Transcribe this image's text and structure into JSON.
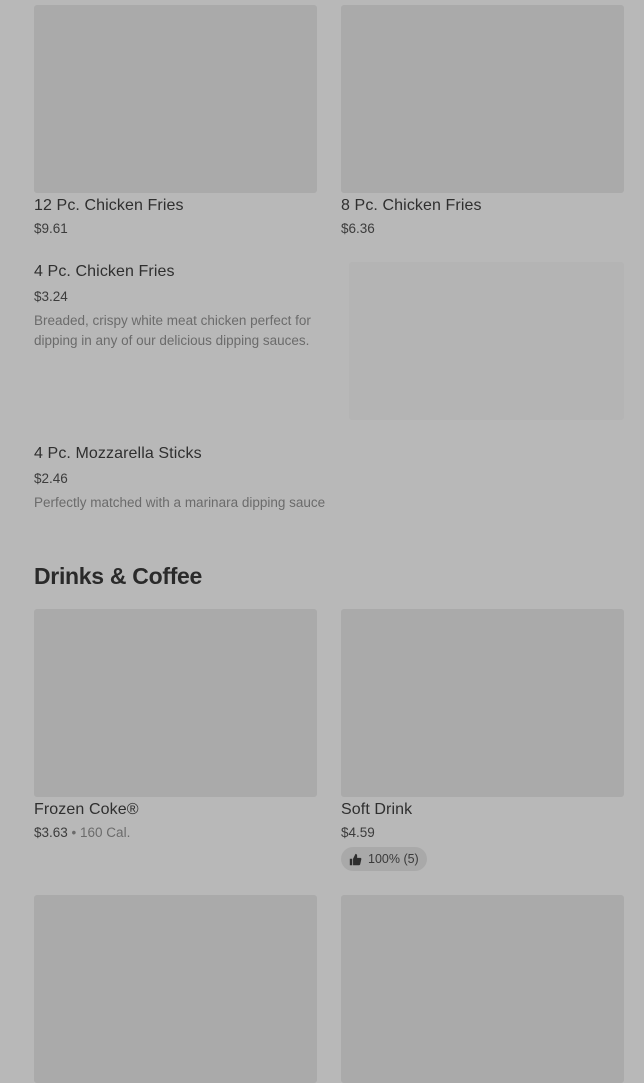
{
  "grid_top": [
    {
      "title": "12 Pc. Chicken Fries",
      "price": "$9.61"
    },
    {
      "title": "8 Pc. Chicken Fries",
      "price": "$6.36"
    }
  ],
  "list_items": [
    {
      "title": "4 Pc. Chicken Fries",
      "price": "$3.24",
      "description": "Breaded, crispy white meat chicken perfect for dipping in any of our delicious dipping sauces."
    },
    {
      "title": "4 Pc. Mozzarella Sticks",
      "price": "$2.46",
      "description": "Perfectly matched with a marinara dipping sauce"
    }
  ],
  "section_drinks": {
    "title": "Drinks & Coffee"
  },
  "drinks": [
    {
      "title": "Frozen Coke®",
      "price": "$3.63",
      "separator": " • ",
      "calories": "160 Cal."
    },
    {
      "title": "Soft Drink",
      "price": "$4.59",
      "rating": "100% (5)"
    }
  ],
  "icons": {
    "rating": "thumbs-up-icon"
  }
}
